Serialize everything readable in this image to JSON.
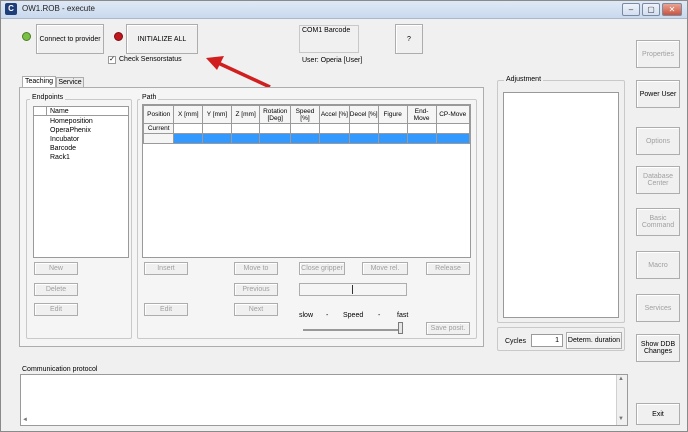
{
  "window": {
    "title": "OW1.ROB - execute",
    "controls": [
      "–",
      "▢",
      "✕"
    ]
  },
  "top": {
    "connect_label": "Connect to provider",
    "initialize_label": "INITIALIZE ALL",
    "check_sensor_label": "Check Sensorstatus",
    "com_label": "COM1 Barcode",
    "help_label": "?",
    "user_label": "User: Operia [User]",
    "status_colors": {
      "connect": "#7ac143",
      "initialize": "#c0161d"
    }
  },
  "tabs": [
    "Teaching",
    "Service"
  ],
  "endpoints": {
    "title": "Endpoints",
    "header": "Name",
    "items": [
      "Homeposition",
      "OperaPhenix",
      "Incubator",
      "Barcode",
      "Rack1"
    ],
    "buttons": [
      "New",
      "Delete",
      "Edit"
    ]
  },
  "path": {
    "title": "Path",
    "columns": [
      "Position",
      "X [mm]",
      "Y [mm]",
      "Z [mm]",
      "Rotation [Deg]",
      "Speed [%]",
      "Accel [%]",
      "Decel [%]",
      "Figure",
      "End-Move",
      "CP-Move"
    ],
    "current_label": "Current",
    "buttons": {
      "insert": "Insert",
      "move_to": "Move to",
      "previous": "Previous",
      "next": "Next",
      "edit": "Edit",
      "close_gripper": "Close gripper",
      "move_rel": "Move rel.",
      "release": "Release",
      "save_posit": "Save posit."
    },
    "speed": {
      "slow": "slow",
      "dash1": "-",
      "label": "Speed",
      "dash2": "-",
      "fast": "fast"
    }
  },
  "adjustment": {
    "title": "Adjustment"
  },
  "cycles": {
    "label": "Cycles",
    "value": "1",
    "button": "Determ. duration"
  },
  "right_buttons": [
    "Properties",
    "Power User",
    "Options",
    "Database Center",
    "Basic Command",
    "Macro",
    "Services",
    "Show DDB Changes",
    "Exit"
  ],
  "communication": {
    "title": "Communication protocol"
  }
}
